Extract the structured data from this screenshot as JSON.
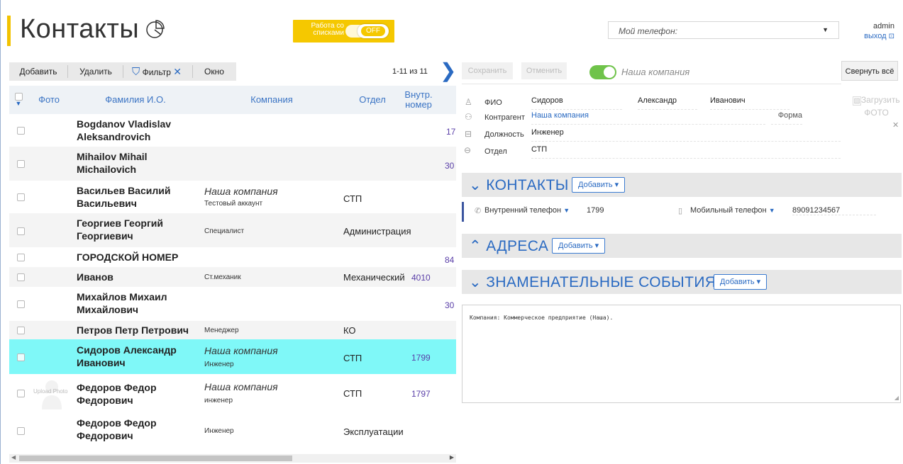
{
  "header": {
    "title": "Контакты",
    "list_mode_label": "Работа со списками",
    "list_mode_state": "OFF",
    "phone_placeholder": "Мой телефон:",
    "user": "admin",
    "logout": "выход"
  },
  "left_toolbar": {
    "add": "Добавить",
    "delete": "Удалить",
    "filter": "Фильтр",
    "window": "Окно",
    "pager": "1-11 из 11"
  },
  "table": {
    "columns": [
      "Фото",
      "Фамилия И.О.",
      "Компания",
      "Отдел",
      "Внутр. номер"
    ],
    "rows": [
      {
        "name1": "Bogdanov Vladislav",
        "name2": "Aleksandrovich",
        "company": "",
        "position": "",
        "dept": "",
        "ext": "17"
      },
      {
        "name1": "Mihailov Mihail",
        "name2": "Michailovich",
        "company": "",
        "position": "",
        "dept": "",
        "ext": "30"
      },
      {
        "name1": "Васильев Василий",
        "name2": "Васильевич",
        "company": "Наша компания",
        "position": "Тестовый аккаунт",
        "dept": "СТП",
        "ext": ""
      },
      {
        "name1": "Георгиев Георгий",
        "name2": "Георгиевич",
        "company": "",
        "position": "Специалист",
        "dept": "Администрация",
        "ext": ""
      },
      {
        "name1": "ГОРОДСКОЙ НОМЕР",
        "name2": "",
        "company": "",
        "position": "",
        "dept": "",
        "ext": "84"
      },
      {
        "name1": "Иванов",
        "name2": "",
        "company": "",
        "position": "Ст.механик",
        "dept": "Механический",
        "ext": "4010"
      },
      {
        "name1": "Михайлов Михаил",
        "name2": "Михайлович",
        "company": "",
        "position": "",
        "dept": "",
        "ext": "30"
      },
      {
        "name1": "Петров Петр Петрович",
        "name2": "",
        "company": "",
        "position": "Менеджер",
        "dept": "КО",
        "ext": ""
      },
      {
        "name1": "Сидоров Александр",
        "name2": "Иванович",
        "company": "Наша компания",
        "position": "Инженер",
        "dept": "СТП",
        "ext": "1799",
        "selected": true
      },
      {
        "name1": "Федоров Федор",
        "name2": "Федорович",
        "company": "Наша компания",
        "position": "инженер",
        "dept": "СТП",
        "ext": "1797",
        "photo_label": "Upload Photo"
      },
      {
        "name1": "Федоров Федор",
        "name2": "Федорович",
        "company": "",
        "position": "Инженер",
        "dept": "Эксплуатации",
        "ext": ""
      }
    ]
  },
  "right_toolbar": {
    "save": "Сохранить",
    "cancel": "Отменить",
    "our_company": "Наша компания",
    "collapse_all": "Свернуть всё"
  },
  "card": {
    "fio_label": "ФИО",
    "last_name": "Сидоров",
    "first_name": "Александр",
    "middle_name": "Иванович",
    "counterparty_label": "Контрагент",
    "counterparty": "Наша компания",
    "form_label": "Форма",
    "position_label": "Должность",
    "position": "Инженер",
    "dept_label": "Отдел",
    "dept": "СТП",
    "photo_upload": "Загрузить ФОТО"
  },
  "sections": {
    "contacts": "КОНТАКТЫ",
    "addresses": "АДРЕСА",
    "events": "ЗНАМЕНАТЕЛЬНЫЕ СОБЫТИЯ",
    "add": "Добавить"
  },
  "contacts": {
    "internal_label": "Внутренний телефон",
    "internal_value": "1799",
    "mobile_label": "Мобильный телефон",
    "mobile_value": "89091234567"
  },
  "notes": "Компания: Коммерческое предприятие (Наша)."
}
